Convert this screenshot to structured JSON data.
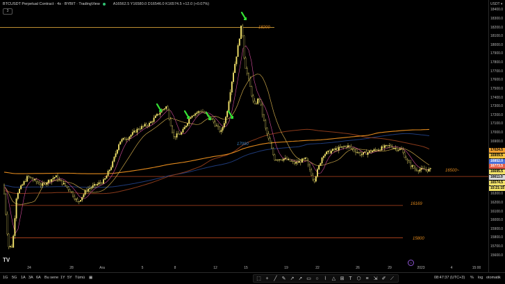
{
  "legend": {
    "symbol": "BTCUSDT Perpetual Contract · 4s · BYBIT · TradingView",
    "ohlc": "A16562.5  Y16580.0  D16546.0  K16574.5  +12.0 (+0.07%)",
    "collapse_label": "3"
  },
  "price_axis": {
    "currency": "USDT ▾",
    "ticks": [
      "18400.0",
      "18300.0",
      "18200.0",
      "18100.0",
      "18000.0",
      "17900.0",
      "17800.0",
      "17700.0",
      "17600.0",
      "17500.0",
      "17400.0",
      "17300.0",
      "17200.0",
      "17100.0",
      "17000.0",
      "16900.0",
      "16800.0",
      "16700.0",
      "16600.0",
      "16500.0",
      "16400.0",
      "16300.0",
      "16200.0",
      "16100.0",
      "16000.0",
      "15900.0",
      "15800.0",
      "15700.0",
      "15600.0"
    ],
    "tags": [
      {
        "label": "17024.5",
        "color": "#f0a030"
      },
      {
        "label": "16909.5",
        "color": "#f4c542"
      },
      {
        "label": "16852.0",
        "color": "#4a6fd8"
      },
      {
        "label": "16773.5",
        "color": "#e35d45"
      },
      {
        "label": "16695.5",
        "color": "#f2e26a"
      },
      {
        "label": "16611.0",
        "color": "#d8d8d8"
      },
      {
        "label": "16574.5",
        "color": "#f2e26a"
      },
      {
        "label": "15:21:15",
        "color": "#f2e26a"
      }
    ]
  },
  "time_axis": {
    "ticks": [
      "24",
      "28",
      "Ara",
      "5",
      "8",
      "12",
      "15",
      "19",
      "22",
      "26",
      "29",
      "2023",
      "4",
      "15:00"
    ]
  },
  "levels": [
    {
      "label": "18200",
      "price": 18200
    },
    {
      "label": "16500~",
      "price": 16500
    },
    {
      "label": "16169",
      "price": 16169
    },
    {
      "label": "15800",
      "price": 15800
    }
  ],
  "annotation_17090": "17090",
  "marker_purple": "9",
  "bottom_bar": {
    "timeframes": [
      "1G",
      "5G",
      "1A",
      "3A",
      "6A",
      "Bu sene",
      "1Y",
      "5Y",
      "Tümü"
    ],
    "tools": [
      "select-icon",
      "crosshair-icon",
      "trendline-icon",
      "pen-icon",
      "ray-icon",
      "arrow-icon",
      "rectangle-icon",
      "circle-icon",
      "path-icon",
      "triangle-icon",
      "ruler-icon",
      "text-icon",
      "price-label-icon",
      "fib-icon",
      "measure-icon",
      "pencil-icon",
      "brush-icon"
    ],
    "clock": "08:47:37 (UTC+3)",
    "percent": "%",
    "log": "log",
    "auto": "otomatik"
  },
  "chart_data": {
    "type": "candlestick",
    "ylim": [
      15550,
      18450
    ],
    "lines": [
      {
        "name": "",
        "color": "#e38a1d"
      },
      {
        "name": "",
        "color": "#1f3b7a"
      },
      {
        "name": "",
        "color": "#8a3a1a"
      },
      {
        "name": "",
        "color": "#f2e26a"
      }
    ]
  }
}
